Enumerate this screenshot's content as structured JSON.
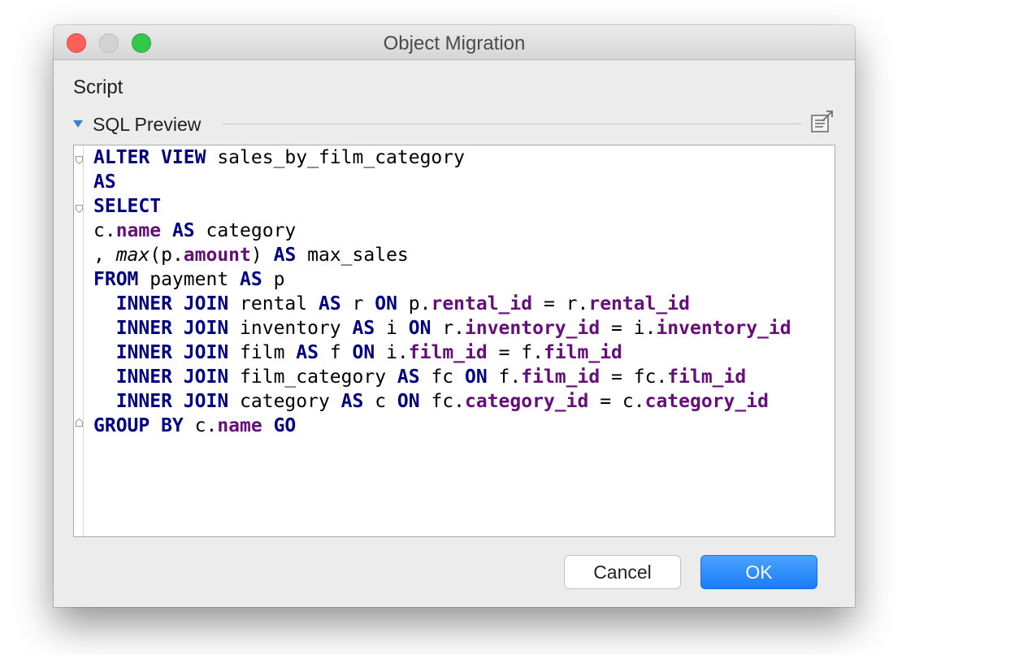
{
  "window": {
    "title": "Object Migration"
  },
  "section": {
    "heading": "Script"
  },
  "preview": {
    "label": "SQL Preview",
    "open_icon": "open-in-editor-icon",
    "accent_color": "#3c7fc2"
  },
  "code": {
    "keyword_color": "#000080",
    "column_color": "#660e7a",
    "lines": [
      [
        {
          "t": "ALTER VIEW",
          "c": "kw"
        },
        {
          "t": " sales_by_film_category"
        }
      ],
      [
        {
          "t": "AS",
          "c": "kw"
        }
      ],
      [
        {
          "t": "SELECT",
          "c": "kw"
        }
      ],
      [
        {
          "t": "c."
        },
        {
          "t": "name",
          "c": "col"
        },
        {
          "t": " "
        },
        {
          "t": "AS",
          "c": "kw"
        },
        {
          "t": " category"
        }
      ],
      [
        {
          "t": ", "
        },
        {
          "t": "max",
          "c": "fn"
        },
        {
          "t": "(p."
        },
        {
          "t": "amount",
          "c": "col"
        },
        {
          "t": ") "
        },
        {
          "t": "AS",
          "c": "kw"
        },
        {
          "t": " max_sales"
        }
      ],
      [
        {
          "t": "FROM",
          "c": "kw"
        },
        {
          "t": " payment "
        },
        {
          "t": "AS",
          "c": "kw"
        },
        {
          "t": " p"
        }
      ],
      [
        {
          "t": "  "
        },
        {
          "t": "INNER JOIN",
          "c": "kw"
        },
        {
          "t": " rental "
        },
        {
          "t": "AS",
          "c": "kw"
        },
        {
          "t": " r "
        },
        {
          "t": "ON",
          "c": "kw"
        },
        {
          "t": " p."
        },
        {
          "t": "rental_id",
          "c": "col"
        },
        {
          "t": " = r."
        },
        {
          "t": "rental_id",
          "c": "col"
        }
      ],
      [
        {
          "t": "  "
        },
        {
          "t": "INNER JOIN",
          "c": "kw"
        },
        {
          "t": " inventory "
        },
        {
          "t": "AS",
          "c": "kw"
        },
        {
          "t": " i "
        },
        {
          "t": "ON",
          "c": "kw"
        },
        {
          "t": " r."
        },
        {
          "t": "inventory_id",
          "c": "col"
        },
        {
          "t": " = i."
        },
        {
          "t": "inventory_id",
          "c": "col"
        }
      ],
      [
        {
          "t": "  "
        },
        {
          "t": "INNER JOIN",
          "c": "kw"
        },
        {
          "t": " film "
        },
        {
          "t": "AS",
          "c": "kw"
        },
        {
          "t": " f "
        },
        {
          "t": "ON",
          "c": "kw"
        },
        {
          "t": " i."
        },
        {
          "t": "film_id",
          "c": "col"
        },
        {
          "t": " = f."
        },
        {
          "t": "film_id",
          "c": "col"
        }
      ],
      [
        {
          "t": "  "
        },
        {
          "t": "INNER JOIN",
          "c": "kw"
        },
        {
          "t": " film_category "
        },
        {
          "t": "AS",
          "c": "kw"
        },
        {
          "t": " fc "
        },
        {
          "t": "ON",
          "c": "kw"
        },
        {
          "t": " f."
        },
        {
          "t": "film_id",
          "c": "col"
        },
        {
          "t": " = fc."
        },
        {
          "t": "film_id",
          "c": "col"
        }
      ],
      [
        {
          "t": "  "
        },
        {
          "t": "INNER JOIN",
          "c": "kw"
        },
        {
          "t": " category "
        },
        {
          "t": "AS",
          "c": "kw"
        },
        {
          "t": " c "
        },
        {
          "t": "ON",
          "c": "kw"
        },
        {
          "t": " fc."
        },
        {
          "t": "category_id",
          "c": "col"
        },
        {
          "t": " = c."
        },
        {
          "t": "category_id",
          "c": "col"
        }
      ],
      [
        {
          "t": "GROUP BY",
          "c": "kw"
        },
        {
          "t": " c."
        },
        {
          "t": "name",
          "c": "col"
        },
        {
          "t": " "
        },
        {
          "t": "GO",
          "c": "kw"
        }
      ]
    ],
    "fold_markers": [
      {
        "line": 0,
        "icon": "fold-open-icon"
      },
      {
        "line": 2,
        "icon": "fold-open-icon"
      },
      {
        "line": 11,
        "icon": "fold-end-icon"
      }
    ]
  },
  "buttons": {
    "cancel_label": "Cancel",
    "ok_label": "OK",
    "ok_color": "#1a7cf6"
  },
  "traffic_lights": {
    "close_color": "#fc605b",
    "minimize_color": "#d2d2d2",
    "zoom_color": "#34c84a"
  }
}
